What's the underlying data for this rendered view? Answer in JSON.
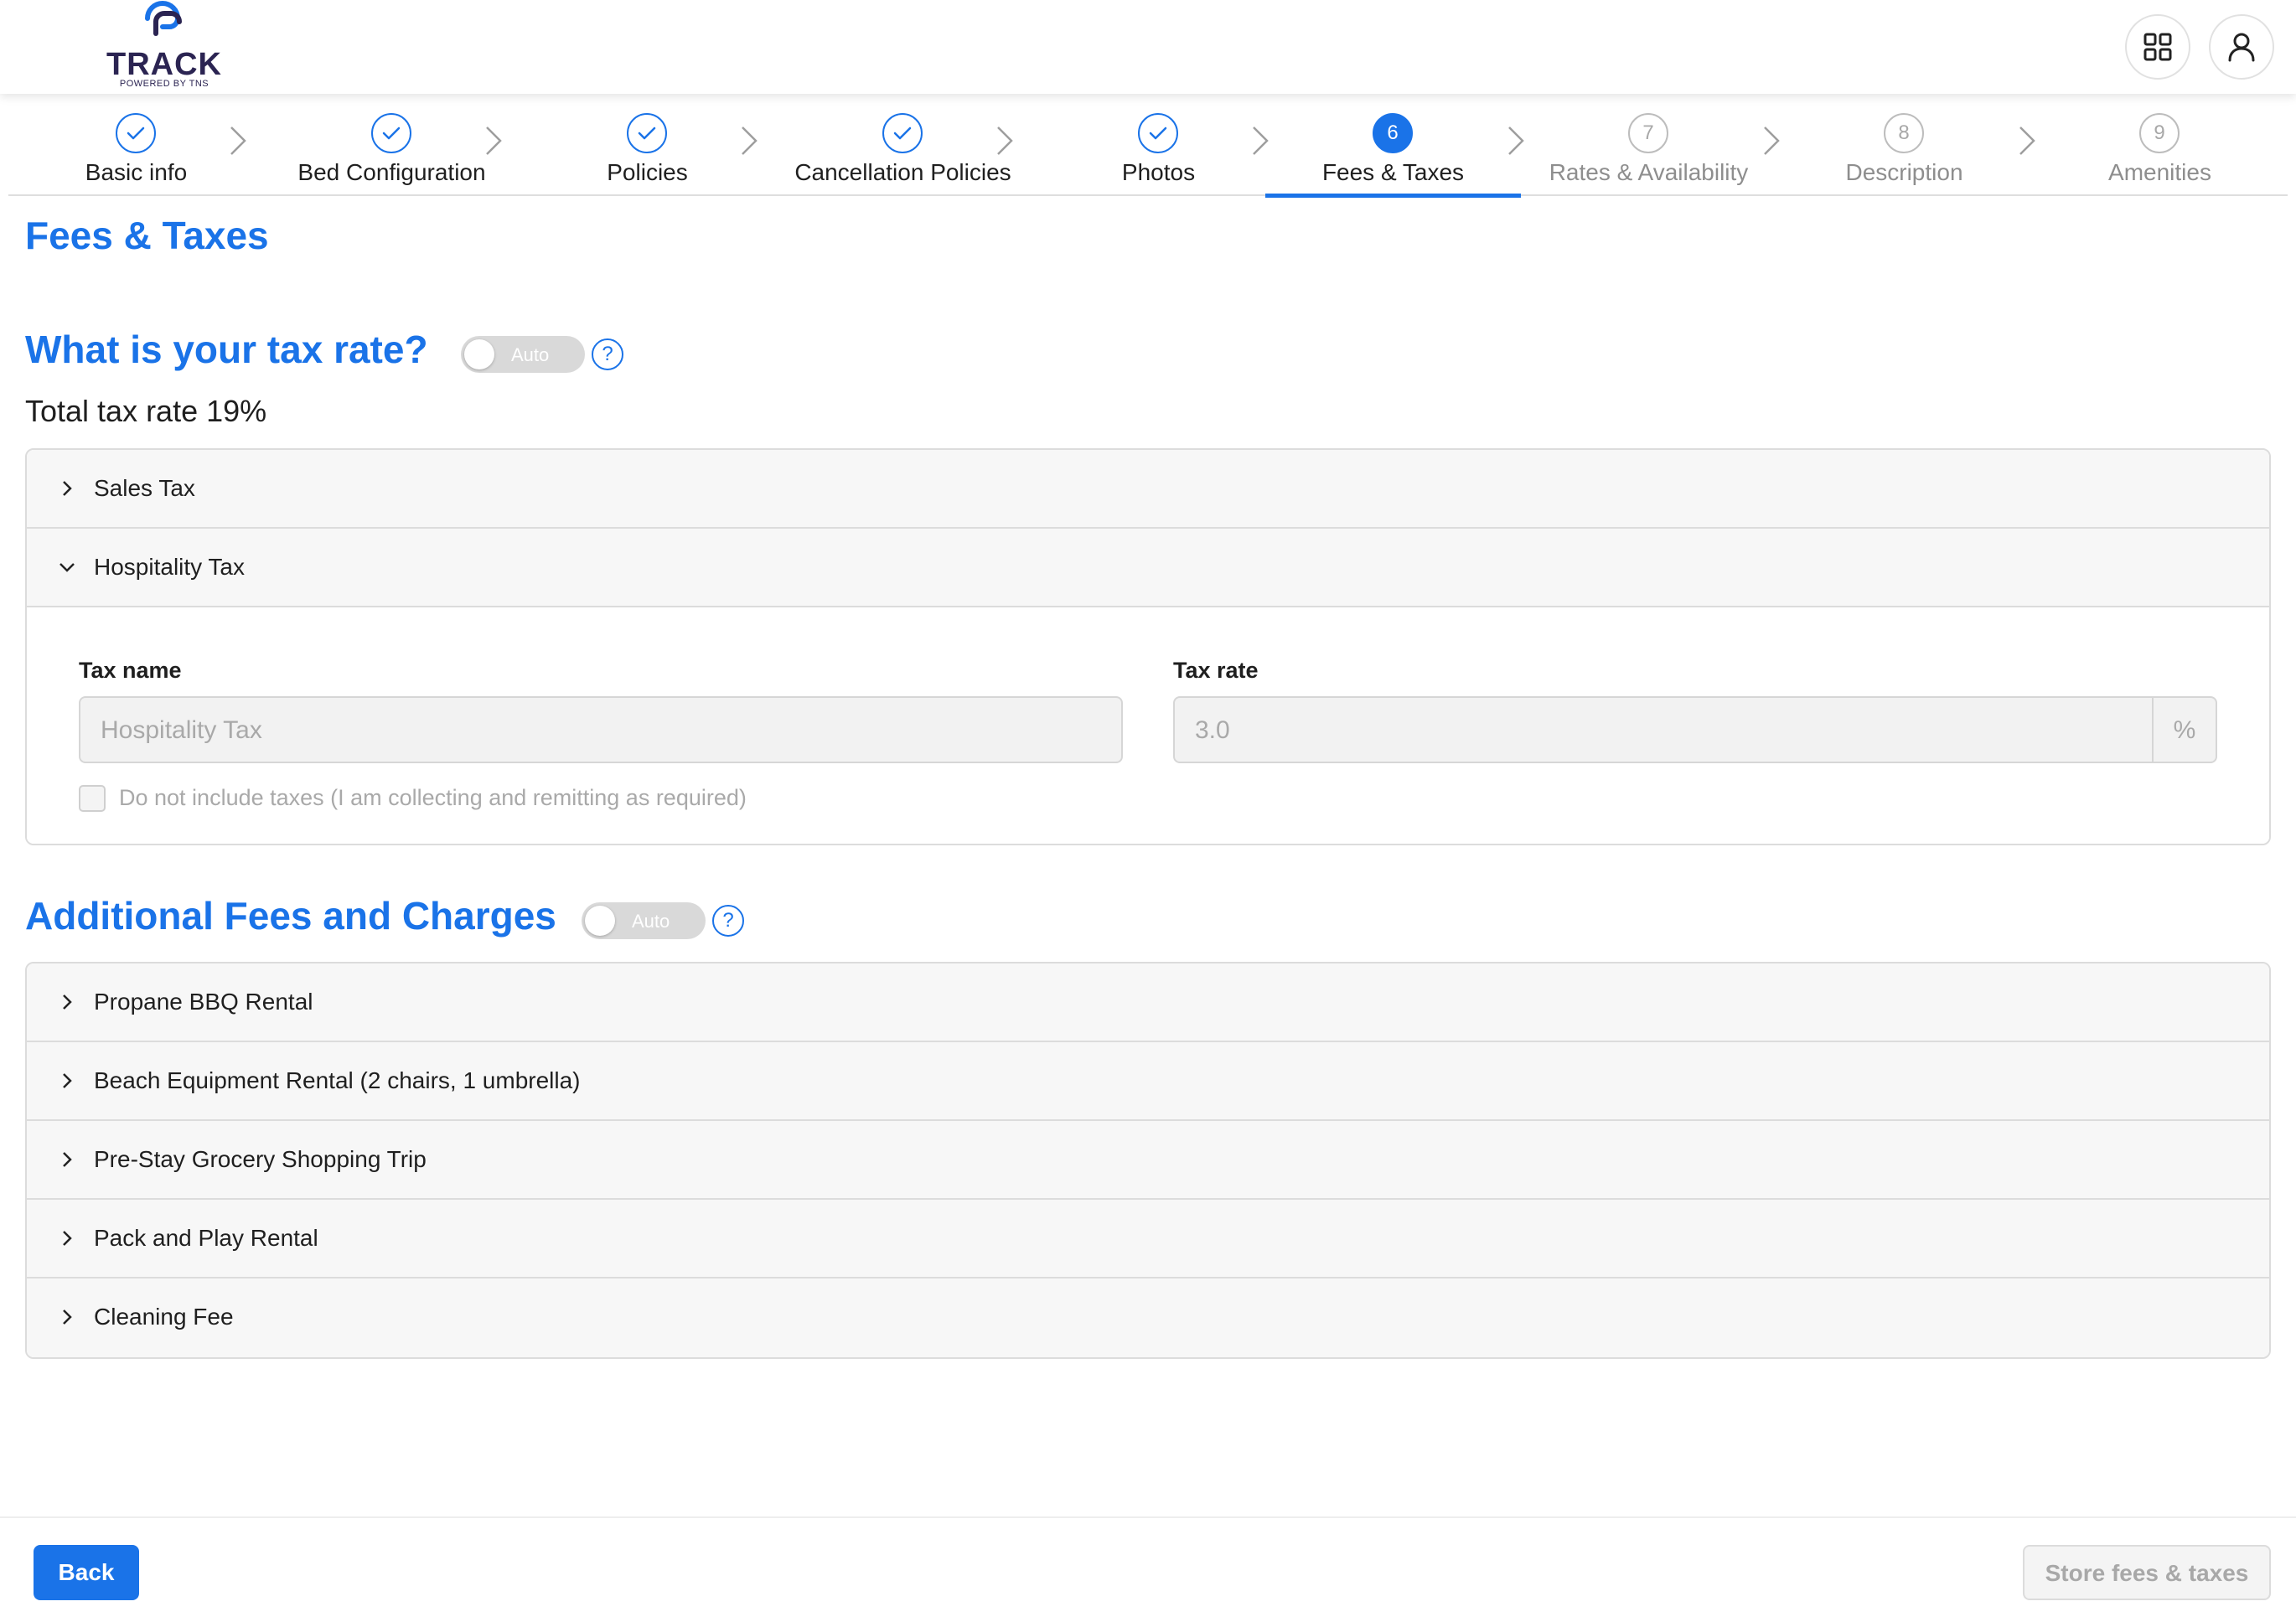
{
  "header": {
    "logo_text": "TRACK",
    "logo_subtext": "POWERED BY TNS",
    "apps_icon": "grid-icon",
    "user_icon": "user-icon"
  },
  "stepper": {
    "steps": [
      {
        "number": "1",
        "label": "Basic info",
        "state": "done"
      },
      {
        "number": "2",
        "label": "Bed Configuration",
        "state": "done"
      },
      {
        "number": "3",
        "label": "Policies",
        "state": "done"
      },
      {
        "number": "4",
        "label": "Cancellation Policies",
        "state": "done"
      },
      {
        "number": "5",
        "label": "Photos",
        "state": "done"
      },
      {
        "number": "6",
        "label": "Fees & Taxes",
        "state": "active"
      },
      {
        "number": "7",
        "label": "Rates & Availability",
        "state": "todo"
      },
      {
        "number": "8",
        "label": "Description",
        "state": "todo"
      },
      {
        "number": "9",
        "label": "Amenities",
        "state": "todo"
      }
    ]
  },
  "page": {
    "title": "Fees & Taxes"
  },
  "tax_section": {
    "title": "What is your tax rate?",
    "toggle_label": "Auto",
    "help_symbol": "?",
    "total_rate": "Total tax rate 19%",
    "items": [
      {
        "label": "Sales Tax",
        "expanded": false
      },
      {
        "label": "Hospitality Tax",
        "expanded": true
      }
    ],
    "form": {
      "tax_name_label": "Tax name",
      "tax_name_value": "Hospitality Tax",
      "tax_rate_label": "Tax rate",
      "tax_rate_value": "3.0",
      "tax_rate_unit": "%",
      "exclude_label": "Do not include taxes (I am collecting and remitting as required)"
    }
  },
  "fees_section": {
    "title": "Additional Fees and Charges",
    "toggle_label": "Auto",
    "help_symbol": "?",
    "items": [
      {
        "label": "Propane BBQ Rental"
      },
      {
        "label": "Beach Equipment Rental (2 chairs, 1 umbrella)"
      },
      {
        "label": "Pre-Stay Grocery Shopping Trip"
      },
      {
        "label": "Pack and Play Rental"
      },
      {
        "label": "Cleaning Fee"
      }
    ]
  },
  "footer": {
    "back_label": "Back",
    "store_label": "Store fees & taxes"
  },
  "colors": {
    "accent": "#1a73e8",
    "brand": "#2b2452"
  }
}
